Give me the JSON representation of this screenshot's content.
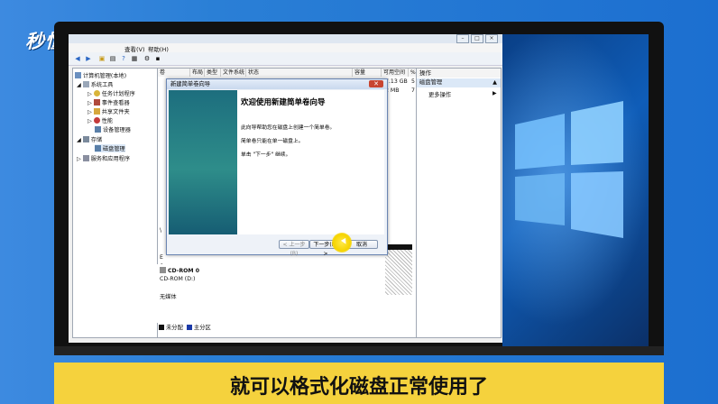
{
  "brand": {
    "logo_text": "秒懂视频"
  },
  "window": {
    "menu": [
      "查看(V)",
      "帮助(H)"
    ],
    "tree": {
      "root": "计算机管理(本地)",
      "items": [
        "系统工具",
        "任务计划程序",
        "事件查看器",
        "共享文件夹",
        "性能",
        "设备管理器",
        "存储",
        "磁盘管理",
        "服务和应用程序"
      ]
    },
    "columns": [
      "卷",
      "布局",
      "类型",
      "文件系统",
      "状态",
      "容量",
      "可用空间",
      "%"
    ],
    "rows": [
      {
        "free": "7.13 GB",
        "pct": "5"
      },
      {
        "free": "2 MB",
        "pct": "7"
      }
    ],
    "actions": {
      "header": "操作",
      "selected": "磁盘管理",
      "more": "更多操作"
    },
    "disk": {
      "name": "CD-ROM 0",
      "type": "CD-ROM (D:)",
      "media": "无媒体"
    },
    "legend": [
      "未分配",
      "主分区"
    ],
    "stray_labels": [
      "\\",
      "E",
      "6",
      "A"
    ]
  },
  "dialog": {
    "title": "新建简单卷向导",
    "heading": "欢迎使用新建简单卷向导",
    "lines": [
      "此向导帮助您在磁盘上创建一个简单卷。",
      "简单卷只能在单一磁盘上。",
      "单击 \"下一步\" 继续。"
    ],
    "buttons": {
      "back": "< 上一步(B)",
      "next": "下一步(N) >",
      "cancel": "取消"
    }
  },
  "subtitle": "就可以格式化磁盘正常使用了",
  "colors": {
    "accent": "#f5d23d",
    "background": "#2f86d8"
  }
}
